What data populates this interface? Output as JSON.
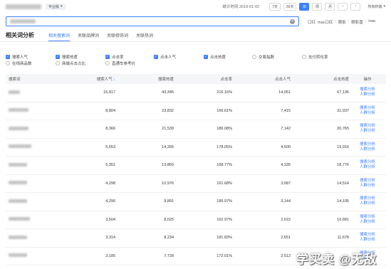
{
  "header": {
    "pro_badge": "专业版",
    "stat_time_label": "统计时间 2019-01-02",
    "ranges": [
      "7天",
      "30天",
      "日",
      "周",
      "月"
    ],
    "active_range": "日",
    "prev_icon": "chevron-left-icon",
    "next_icon": "chevron-right-icon",
    "channel_label": "所有终端"
  },
  "search": {
    "value": "",
    "placeholder": "",
    "clear_icon": "close-circle-icon"
  },
  "devices": [
    "口红",
    "mac口红",
    "|",
    "眼影",
    "|",
    "眼影盘",
    "|",
    "mac"
  ],
  "section": {
    "title": "相关词分析",
    "tabs": [
      "相关搜索词",
      "关联品牌词",
      "关联修饰词",
      "关联热词"
    ],
    "active_tab": "相关搜索词"
  },
  "metrics": [
    {
      "label": "搜索人气",
      "checked": true
    },
    {
      "label": "搜索热度",
      "checked": true
    },
    {
      "label": "点击率",
      "checked": true
    },
    {
      "label": "点击人气",
      "checked": true
    },
    {
      "label": "点击热度",
      "checked": true
    },
    {
      "label": "交易指数",
      "checked": false
    },
    {
      "label": "支付转化率",
      "checked": false
    },
    {
      "label": "在线商品数",
      "checked": false
    },
    {
      "label": "商城点击占比",
      "checked": false
    },
    {
      "label": "直通车参考价",
      "checked": false
    }
  ],
  "table": {
    "headers": [
      "搜索词",
      "搜索人气",
      "搜索热度",
      "点击率",
      "点击人气",
      "点击热度",
      "操作"
    ],
    "op_links": [
      "搜索分析",
      "人群分析"
    ],
    "rows": [
      [
        "16,817",
        "43,345",
        "216.16%",
        "14,051",
        "67,136"
      ],
      [
        "8,804",
        "23,832",
        "166.61%",
        "7,415",
        "31,937"
      ],
      [
        "8,366",
        "21,539",
        "186.08%",
        "7,142",
        "30,765"
      ],
      [
        "5,553",
        "14,266",
        "178.05%",
        "4,500",
        "19,916"
      ],
      [
        "5,351",
        "13,869",
        "168.77%",
        "4,335",
        "18,776"
      ],
      [
        "4,298",
        "10,976",
        "161.68%",
        "3,687",
        "14,514"
      ],
      [
        "4,296",
        "9,891",
        "185.97%",
        "3,144",
        "14,195"
      ],
      [
        "3,504",
        "8,025",
        "162.97%",
        "2,615",
        "10,681"
      ],
      [
        "3,314",
        "8,234",
        "181.83%",
        "2,651",
        "11,678"
      ],
      [
        "3,185",
        "7,728",
        "172.01%",
        "2,512",
        ""
      ]
    ]
  },
  "watermark": "学买卖 @无敌",
  "colors": {
    "accent": "#3d7fff"
  }
}
